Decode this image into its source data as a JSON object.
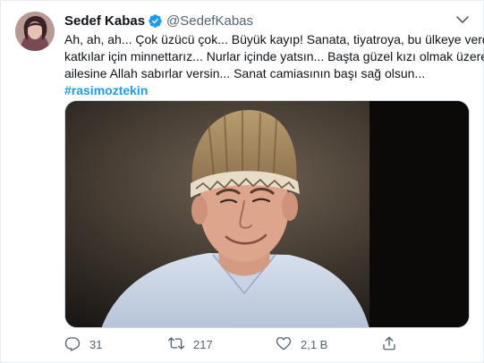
{
  "author": {
    "name": "Sedef Kabas",
    "handle": "@SedefKabas"
  },
  "tweet": {
    "lines": [
      "Ah, ah, ah... Çok üzücü çok... Büyük kayıp! Sanata, tiyatroya, bu ülkeye verdi",
      "katkılar için minnettarız... Nurlar içinde yatsın... Başta güzel kızı olmak üzere",
      "ailesine Allah sabırlar versin... Sanat camiasının başı sağ olsun..."
    ],
    "hashtag": "#rasimoztekin"
  },
  "actions": {
    "replies": "31",
    "retweets": "217",
    "likes": "2,1 B"
  },
  "colors": {
    "accent": "#1d9bf0",
    "text": "#0f1419",
    "muted": "#536471",
    "border": "#e6ecf0"
  },
  "icons": [
    "verified-badge-icon",
    "more-icon",
    "reply-icon",
    "retweet-icon",
    "like-icon",
    "share-icon"
  ]
}
